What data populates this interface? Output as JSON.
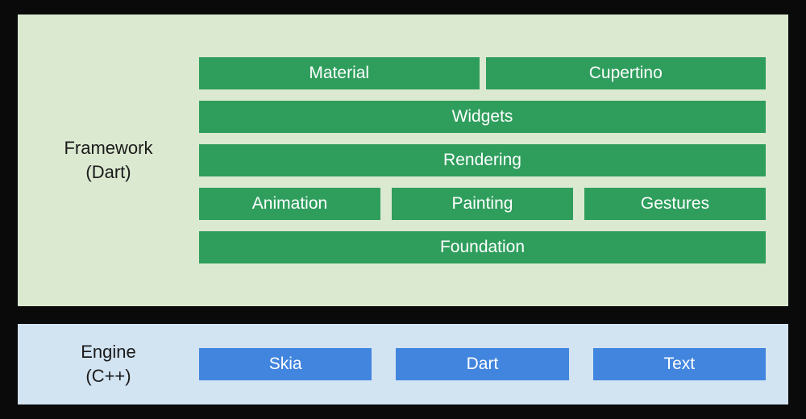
{
  "framework": {
    "label_line1": "Framework",
    "label_line2": "(Dart)",
    "rows": {
      "top": [
        "Material",
        "Cupertino"
      ],
      "widgets": "Widgets",
      "rendering": "Rendering",
      "mid": [
        "Animation",
        "Painting",
        "Gestures"
      ],
      "foundation": "Foundation"
    }
  },
  "engine": {
    "label_line1": "Engine",
    "label_line2": "(C++)",
    "items": [
      "Skia",
      "Dart",
      "Text"
    ]
  },
  "colors": {
    "framework_bg": "#dbe9d0",
    "framework_block": "#2f9e5d",
    "engine_bg": "#d2e3f1",
    "engine_block": "#4285de"
  }
}
